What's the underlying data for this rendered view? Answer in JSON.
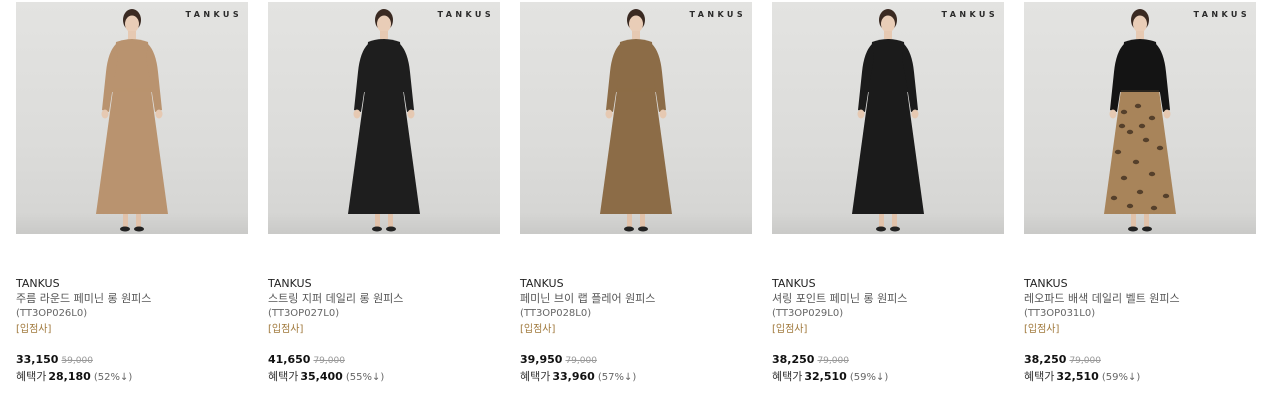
{
  "watermark": "TANKUS",
  "products": [
    {
      "brand": "TANKUS",
      "title": "주름 라운드 페미닌 롱 원피스",
      "code": "(TT3OP026L0)",
      "seller": "[입점사]",
      "price": "33,150",
      "original_price": "59,000",
      "benefit_label": "혜택가",
      "benefit_price": "28,180",
      "rate": "(52%↓)",
      "dress_color": "#b9936f",
      "hem_color": "#b9936f",
      "sleeve_color": "#b9936f"
    },
    {
      "brand": "TANKUS",
      "title": "스트링 지퍼 데일리 롱 원피스",
      "code": "(TT3OP027L0)",
      "seller": "[입점사]",
      "price": "41,650",
      "original_price": "79,000",
      "benefit_label": "혜택가",
      "benefit_price": "35,400",
      "rate": "(55%↓)",
      "dress_color": "#1e1e1e",
      "hem_color": "#1e1e1e",
      "sleeve_color": "#1e1e1e"
    },
    {
      "brand": "TANKUS",
      "title": "페미닌 브이 랩 플레어 원피스",
      "code": "(TT3OP028L0)",
      "seller": "[입점사]",
      "price": "39,950",
      "original_price": "79,000",
      "benefit_label": "혜택가",
      "benefit_price": "33,960",
      "rate": "(57%↓)",
      "dress_color": "#8c6c47",
      "hem_color": "#8c6c47",
      "sleeve_color": "#8c6c47"
    },
    {
      "brand": "TANKUS",
      "title": "셔링 포인트 페미닌 롱 원피스",
      "code": "(TT3OP029L0)",
      "seller": "[입점사]",
      "price": "38,250",
      "original_price": "79,000",
      "benefit_label": "혜택가",
      "benefit_price": "32,510",
      "rate": "(59%↓)",
      "dress_color": "#1b1b1b",
      "hem_color": "#1b1b1b",
      "sleeve_color": "#1b1b1b"
    },
    {
      "brand": "TANKUS",
      "title": "레오파드 배색 데일리 벨트 원피스",
      "code": "(TT3OP031L0)",
      "seller": "[입점사]",
      "price": "38,250",
      "original_price": "79,000",
      "benefit_label": "혜택가",
      "benefit_price": "32,510",
      "rate": "(59%↓)",
      "dress_color": "#141414",
      "hem_color": "#a8845a",
      "sleeve_color": "#141414"
    }
  ]
}
